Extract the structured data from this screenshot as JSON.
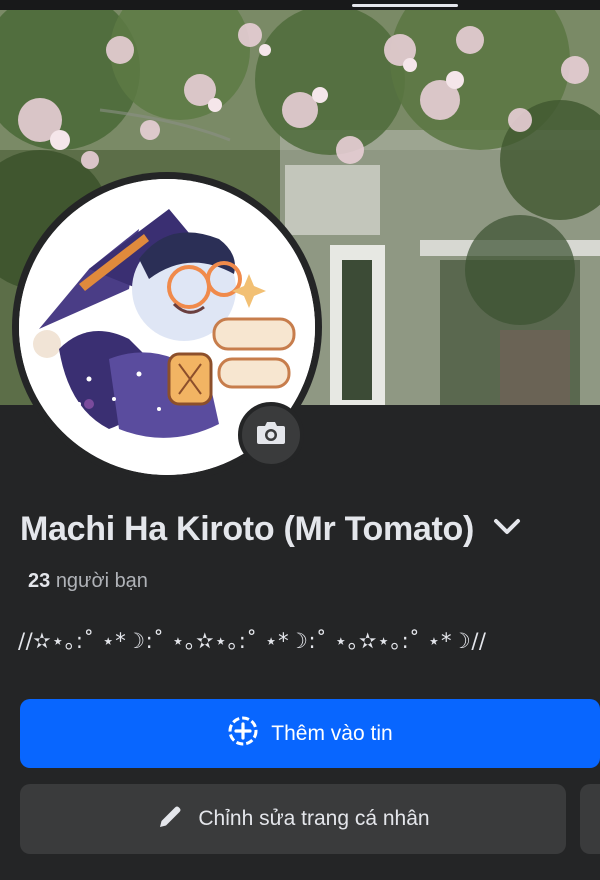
{
  "profile": {
    "name": "Machi Ha Kiroto (Mr Tomato)",
    "friends_count": "23",
    "friends_label": "người bạn",
    "bio": "//✫⋆｡:˚ ⋆*☽:˚ ⋆｡✫⋆｡:˚ ⋆*☽:˚ ⋆｡✫⋆｡:˚ ⋆*☽//"
  },
  "actions": {
    "add_to_story": "Thêm vào tin",
    "edit_profile": "Chỉnh sửa trang cá nhân"
  },
  "icons": {
    "camera": "camera-icon",
    "dropdown": "chevron-down-icon",
    "add_story": "plus-circle-icon",
    "edit": "pencil-icon"
  },
  "colors": {
    "background": "#242526",
    "primary_button": "#0866ff",
    "secondary_button": "#3a3b3c",
    "text": "#e4e6eb",
    "muted_text": "#b0b3b8"
  }
}
